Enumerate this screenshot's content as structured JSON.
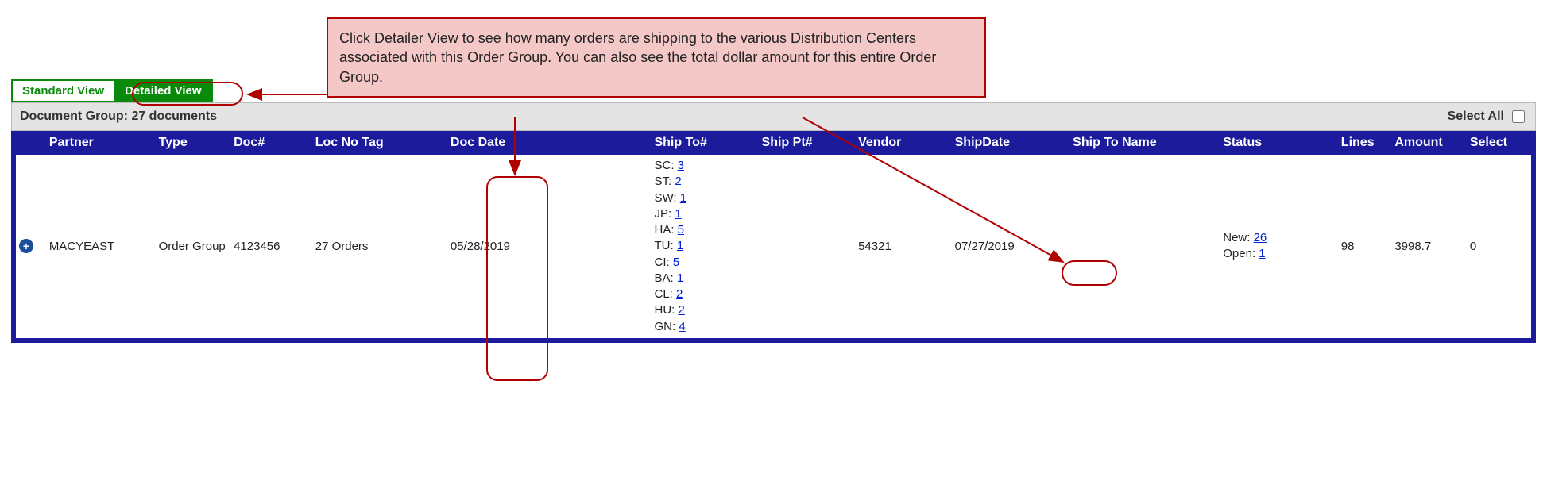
{
  "callout": "Click Detailer View to see how many orders are shipping to the various Distribution Centers associated with this Order Group. You can also see the total dollar amount for this entire Order Group.",
  "tabs": {
    "standard": "Standard View",
    "detailed": "Detailed View"
  },
  "docGroupLabel": "Document Group: 27 documents",
  "selectAllLabel": "Select All",
  "headers": {
    "partner": "Partner",
    "type": "Type",
    "docno": "Doc#",
    "locnotag": "Loc No Tag",
    "docdate": "Doc Date",
    "shiptonum": "Ship To#",
    "shipptnum": "Ship Pt#",
    "vendor": "Vendor",
    "shipdate": "ShipDate",
    "shiptoname": "Ship To Name",
    "status": "Status",
    "lines": "Lines",
    "amount": "Amount",
    "select": "Select"
  },
  "row": {
    "partner": "MACYEAST",
    "type": "Order Group",
    "docno": "4123456",
    "locnotag": "27 Orders",
    "docdate": "05/28/2019",
    "shipto": {
      "SC": "3",
      "ST": "2",
      "SW": "1",
      "JP": "1",
      "HA": "5",
      "TU": "1",
      "CI": "5",
      "BA": "1",
      "CL": "2",
      "HU": "2",
      "GN": "4"
    },
    "shipptnum": "",
    "vendor": "54321",
    "shipdate": "07/27/2019",
    "shiptoname": "",
    "status": {
      "New": "26",
      "Open": "1"
    },
    "lines": "98",
    "amount": "3998.7",
    "select": "0"
  }
}
